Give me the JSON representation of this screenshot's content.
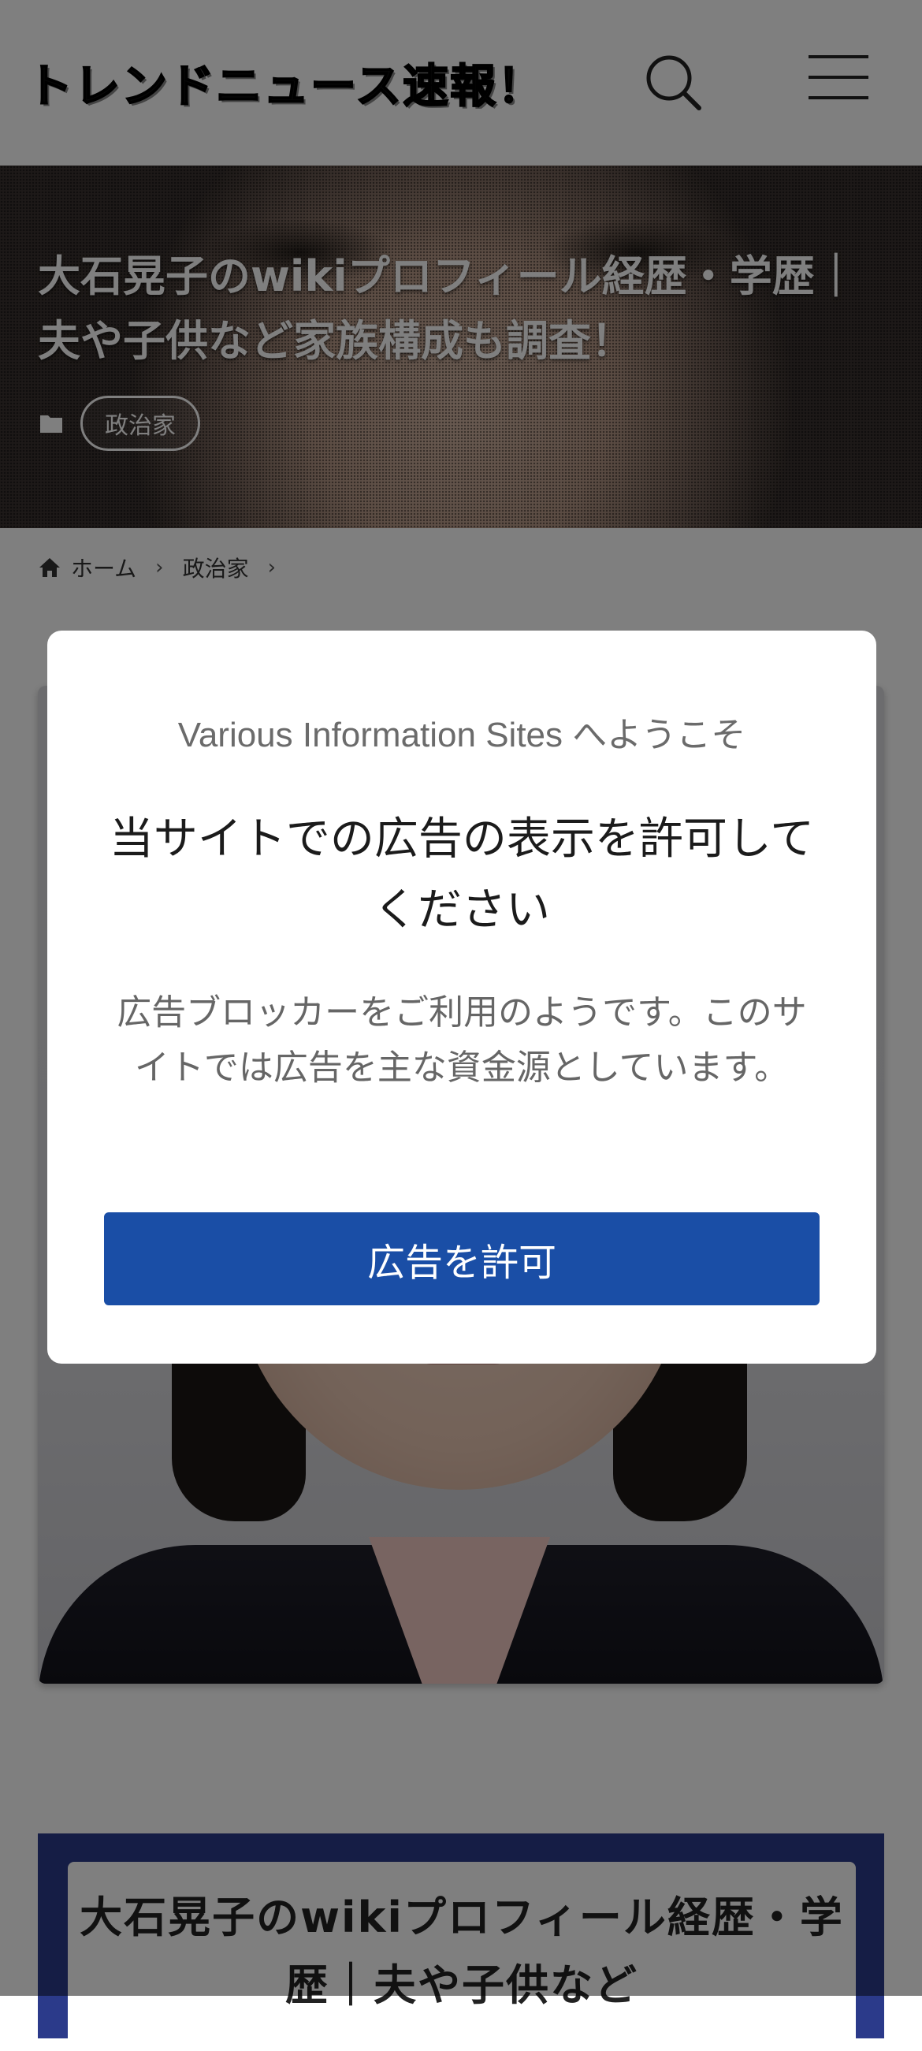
{
  "header": {
    "site_title": "トレンドニュース速報！",
    "search_icon": "search-icon",
    "menu_icon": "hamburger-menu-icon"
  },
  "hero": {
    "title": "大石晃子のwikiプロフィール経歴・学歴｜夫や子供など家族構成も調査！",
    "category_icon": "folder-icon",
    "category": "政治家"
  },
  "breadcrumb": {
    "home_icon": "home-icon",
    "home": "ホーム",
    "separator": "›",
    "category": "政治家"
  },
  "toc": {
    "title": "大石晃子のwikiプロフィール経歴・学歴｜夫や子供など"
  },
  "modal": {
    "welcome": "Various Information Sites へようこそ",
    "heading": "当サイトでの広告の表示を許可してください",
    "body": "広告ブロッカーをご利用のようです。このサイトでは広告を主な資金源としています。",
    "button": "広告を許可",
    "button_color": "#1a4ea6"
  }
}
